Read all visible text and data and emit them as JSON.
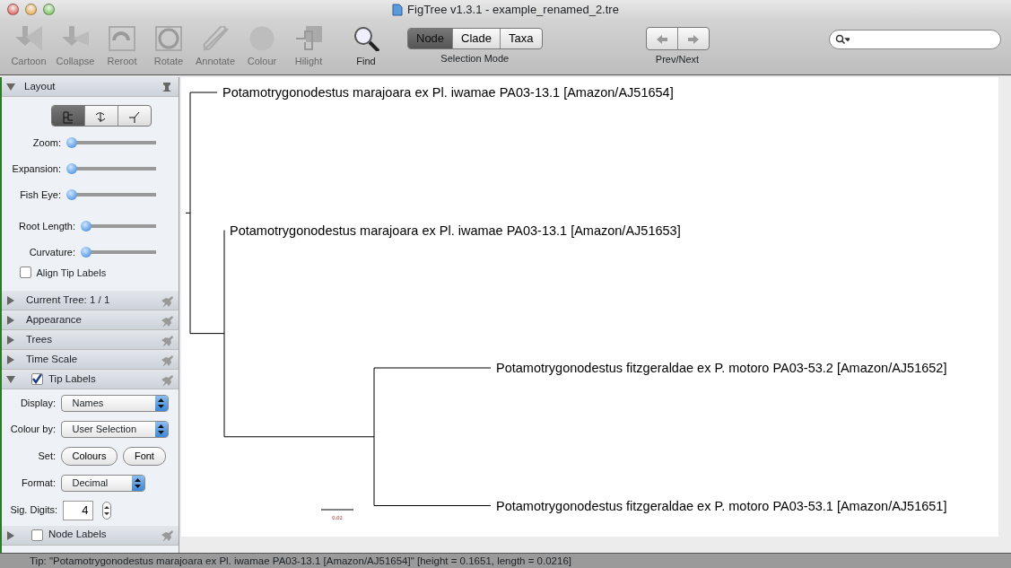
{
  "window": {
    "title": "FigTree v1.3.1 - example_renamed_2.tre"
  },
  "toolbar": {
    "tools": [
      {
        "label": "Cartoon",
        "kind": "cartoon",
        "disabled": true
      },
      {
        "label": "Collapse",
        "kind": "collapse",
        "disabled": true
      },
      {
        "label": "Reroot",
        "kind": "reroot",
        "disabled": true
      },
      {
        "label": "Rotate",
        "kind": "rotate",
        "disabled": true
      },
      {
        "label": "Annotate",
        "kind": "annotate",
        "disabled": true
      },
      {
        "label": "Colour",
        "kind": "colour",
        "disabled": true
      },
      {
        "label": "Hilight",
        "kind": "hilight",
        "disabled": true
      },
      {
        "label": "Find",
        "kind": "find",
        "disabled": false
      }
    ],
    "selection_mode": {
      "label": "Selection Mode",
      "options": [
        {
          "label": "Node",
          "selected": true
        },
        {
          "label": "Clade",
          "selected": false
        },
        {
          "label": "Taxa",
          "selected": false
        }
      ]
    },
    "nav": {
      "label": "Prev/Next"
    }
  },
  "sidebar": {
    "sections": [
      {
        "title": "Layout",
        "expanded": true,
        "kind": "layout",
        "layout_modes": [
          {
            "kind": "rectangle",
            "selected": true
          },
          {
            "kind": "polar",
            "selected": false
          },
          {
            "kind": "radial",
            "selected": false
          }
        ],
        "sliders": [
          {
            "label": "Zoom:",
            "level": 0
          },
          {
            "label": "Expansion:",
            "level": 0
          },
          {
            "label": "Fish Eye:",
            "level": 0
          },
          {
            "label": "Root Length:",
            "level": 0
          },
          {
            "label": "Curvature:",
            "level": 0
          }
        ],
        "checkbox": {
          "label": "Align Tip Labels",
          "checked": false
        }
      },
      {
        "title": "Current Tree: 1 / 1",
        "expanded": false,
        "kind": "plain"
      },
      {
        "title": "Appearance",
        "expanded": false,
        "kind": "plain"
      },
      {
        "title": "Trees",
        "expanded": false,
        "kind": "plain"
      },
      {
        "title": "Time Scale",
        "expanded": false,
        "kind": "plain"
      },
      {
        "title": "Tip Labels",
        "expanded": true,
        "kind": "tips",
        "checked": true,
        "display": {
          "label": "Display:",
          "value": "Names"
        },
        "colour_by": {
          "label": "Colour by:",
          "value": "User Selection"
        },
        "set": {
          "label": "Set:",
          "buttons": [
            "Colours",
            "Font"
          ]
        },
        "format": {
          "label": "Format:",
          "value": "Decimal"
        },
        "digits": {
          "label": "Sig. Digits:",
          "value": "4"
        }
      },
      {
        "title": "Node Labels",
        "expanded": false,
        "kind": "plain",
        "checked": false
      }
    ]
  },
  "tree": {
    "children": [
      {
        "label": "Potamotrygonodestus marajoara ex Pl. iwamae PA03-13.1 [Amazon/AJ51654]"
      },
      {
        "children": [
          {
            "label": "Potamotrygonodestus marajoara ex Pl. iwamae  PA03-13.1 [Amazon/AJ51653]"
          },
          {
            "children": [
              {
                "label": "Potamotrygonodestus fitzgeraldae ex P. motoro  PA03-53.2 [Amazon/AJ51652]"
              },
              {
                "label": "Potamotrygonodestus fitzgeraldae ex P. motoro  PA03-53.1 [Amazon/AJ51651]"
              }
            ]
          }
        ]
      }
    ]
  },
  "scale_bar": {
    "label": "0.02"
  },
  "status_bar": {
    "text": "Tip: \"Potamotrygonodestus marajoara ex Pl. iwamae PA03-13.1 [Amazon/AJ51654]\" [height = 0.1651, length = 0.0216]"
  }
}
